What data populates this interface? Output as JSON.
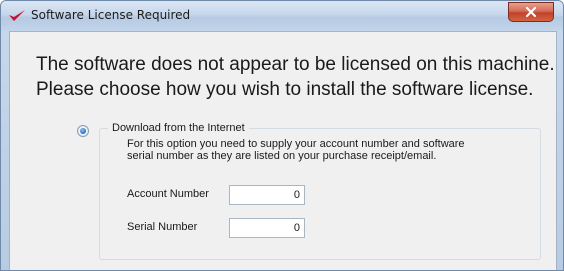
{
  "window": {
    "title": "Software License Required",
    "close_label": "X"
  },
  "message": {
    "line1": "The software does not appear to be licensed on this machine.",
    "line2": "Please choose how you wish to install the software license."
  },
  "option_download": {
    "label": "Download from the Internet",
    "selected": true,
    "description_line1": "For this option you need to supply your account number and software",
    "description_line2": "serial number as they are listed on your purchase receipt/email."
  },
  "fields": {
    "account_number": {
      "label": "Account Number",
      "value": "0"
    },
    "serial_number": {
      "label": "Serial Number",
      "value": "0"
    }
  },
  "colors": {
    "app_icon": "#c8102e",
    "accent_radio": "#2a6fbf",
    "close_button": "#c2412c"
  },
  "icons": {
    "app": "checkmark-logo-icon",
    "close": "close-icon",
    "radio": "radio-selected-icon"
  }
}
